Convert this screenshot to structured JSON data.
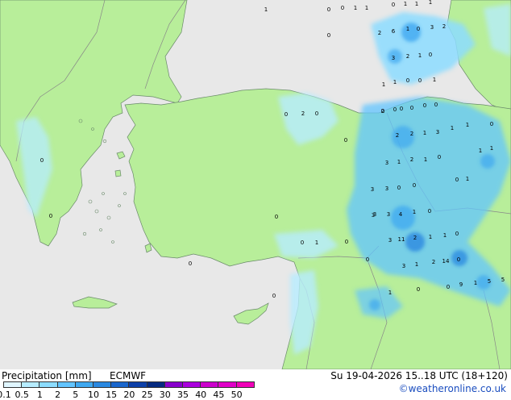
{
  "map": {
    "colors": {
      "sea": "#e8e8e8",
      "land": "#b8ee9a",
      "coast": "#6a8a6a",
      "border": "#888888"
    },
    "precip_labels": [
      {
        "t": "1"
      },
      {
        "t": "0"
      },
      {
        "t": "0"
      },
      {
        "t": "1"
      },
      {
        "t": "1"
      },
      {
        "t": "0"
      },
      {
        "t": "1"
      },
      {
        "t": "1"
      },
      {
        "t": "1"
      },
      {
        "t": "0"
      },
      {
        "t": "2"
      },
      {
        "t": "6"
      },
      {
        "t": "1"
      },
      {
        "t": "0"
      },
      {
        "t": "3"
      },
      {
        "t": "2"
      },
      {
        "t": "3"
      },
      {
        "t": "2"
      },
      {
        "t": "1"
      },
      {
        "t": "0"
      },
      {
        "t": "1"
      },
      {
        "t": "1"
      },
      {
        "t": "0"
      },
      {
        "t": "0"
      },
      {
        "t": "1"
      },
      {
        "t": "0"
      },
      {
        "t": "0"
      },
      {
        "t": "0"
      },
      {
        "t": "0"
      },
      {
        "t": "0"
      },
      {
        "t": "0"
      },
      {
        "t": "2"
      },
      {
        "t": "2"
      },
      {
        "t": "2"
      },
      {
        "t": "1"
      },
      {
        "t": "3"
      },
      {
        "t": "1"
      },
      {
        "t": "1"
      },
      {
        "t": "0"
      },
      {
        "t": "1"
      },
      {
        "t": "3"
      },
      {
        "t": "1"
      },
      {
        "t": "2"
      },
      {
        "t": "1"
      },
      {
        "t": "0"
      },
      {
        "t": "0"
      },
      {
        "t": "1"
      },
      {
        "t": "1"
      },
      {
        "t": "3"
      },
      {
        "t": "3"
      },
      {
        "t": "0"
      },
      {
        "t": "0"
      },
      {
        "t": "0"
      },
      {
        "t": "0"
      },
      {
        "t": "1"
      },
      {
        "t": "3"
      },
      {
        "t": "3"
      },
      {
        "t": "3"
      },
      {
        "t": "4"
      },
      {
        "t": "1"
      },
      {
        "t": "0"
      },
      {
        "t": "3"
      },
      {
        "t": "11"
      },
      {
        "t": "2"
      },
      {
        "t": "1"
      },
      {
        "t": "1"
      },
      {
        "t": "0"
      },
      {
        "t": "0"
      },
      {
        "t": "0"
      },
      {
        "t": "1"
      },
      {
        "t": "3"
      },
      {
        "t": "1"
      },
      {
        "t": "2"
      },
      {
        "t": "14"
      },
      {
        "t": "0"
      },
      {
        "t": "0"
      },
      {
        "t": "0"
      },
      {
        "t": "9"
      },
      {
        "t": "1"
      },
      {
        "t": "5"
      },
      {
        "t": "5"
      },
      {
        "t": "0"
      },
      {
        "t": "0"
      },
      {
        "t": "0"
      },
      {
        "t": "0"
      },
      {
        "t": "0"
      },
      {
        "t": "2"
      },
      {
        "t": "0"
      },
      {
        "t": "0"
      }
    ]
  },
  "footer": {
    "title": "Precipitation [mm]",
    "model": "ECMWF",
    "validity": "Su 19-04-2026 15..18 UTC (18+120)",
    "credit": "©weatheronline.co.uk",
    "scale": {
      "ticks": [
        "0.1",
        "0.5",
        "1",
        "2",
        "5",
        "10",
        "15",
        "20",
        "25",
        "30",
        "35",
        "40",
        "45",
        "50"
      ],
      "colors": [
        "#e0f6ff",
        "#b6ecff",
        "#8cdcff",
        "#62c4ff",
        "#3fa8f0",
        "#2a88e0",
        "#1a66cc",
        "#0d40a8",
        "#062a80",
        "#8800cc",
        "#aa00dd",
        "#cc00cc",
        "#e000c8",
        "#f000b8"
      ]
    }
  }
}
